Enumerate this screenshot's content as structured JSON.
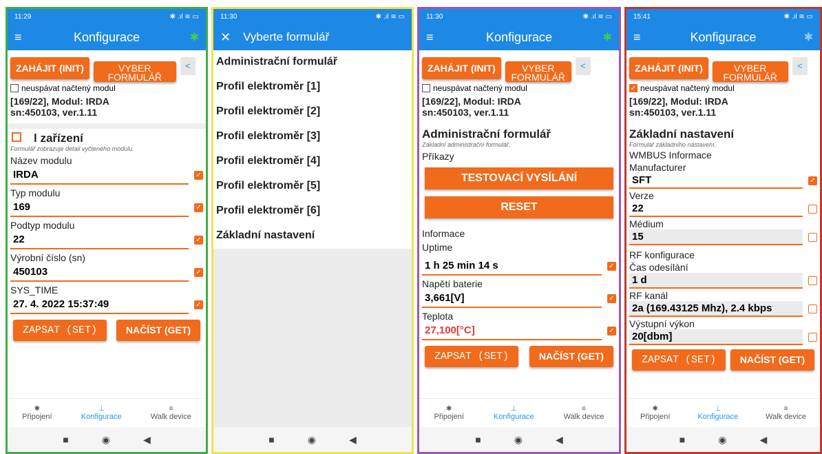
{
  "colors": {
    "accent": "#f26a1b",
    "appbar": "#1e88e5",
    "phone1_border": "#3fae49",
    "phone2_border": "#f0e44a",
    "phone3_border": "#9b59b6",
    "phone4_border": "#c0392b"
  },
  "common": {
    "title_config": "Konfigurace",
    "init": "ZAHÁJIT (INIT)",
    "vyber": "VYBER FORMULÁŘ",
    "no_sleep": "neuspávat načtený modul",
    "module_info_1": "[169/22], Modul: IRDA",
    "module_info_2": "sn:450103, ver.1.11",
    "set": "ZAPSAT (SET)",
    "get": "NAČÍST (GET)",
    "nav_conn": "Připojení",
    "nav_conf": "Konfigurace",
    "nav_walk": "Walk device"
  },
  "phone1": {
    "time": "11:29",
    "form_title": "l zařízení",
    "form_desc": "Formulář zobrazuje detail vyčteného modulu.",
    "fields": [
      {
        "label": "Název modulu",
        "value": "IRDA"
      },
      {
        "label": "Typ modulu",
        "value": "169"
      },
      {
        "label": "Podtyp modulu",
        "value": "22"
      },
      {
        "label": "Výrobní číslo (sn)",
        "value": "450103"
      },
      {
        "label": "SYS_TIME",
        "value": "27. 4. 2022 15:37:49"
      }
    ]
  },
  "phone2": {
    "time": "11:30",
    "title": "Vyberte formulář",
    "items": [
      "Administrační formulář",
      "Profil elektroměr [1]",
      "Profil elektroměr [2]",
      "Profil elektroměr [3]",
      "Profil elektroměr [4]",
      "Profil elektroměr [5]",
      "Profil elektroměr [6]",
      "Základní nastavení"
    ]
  },
  "phone3": {
    "time": "11:30",
    "form_title": "Administrační formulář",
    "form_desc": "Základní administrační formulář.",
    "commands": "Příkazy",
    "btn_test": "TESTOVACÍ VYSÍLÁNÍ",
    "btn_reset": "RESET",
    "info": "Informace",
    "fields": [
      {
        "label": "Uptime",
        "value": "1 h 25 min 14 s"
      },
      {
        "label": "Napětí baterie",
        "value": "3,661[V]"
      },
      {
        "label": "Teplota",
        "value": "27,100[°C]"
      }
    ]
  },
  "phone4": {
    "time": "15:41",
    "form_title": "Základní nastavení",
    "form_desc": "Formulář základního nastavení.",
    "wmbus": "WMBUS Informace",
    "rf_conf": "RF konfigurace",
    "fields": [
      {
        "label": "Manufacturer",
        "value": "SFT"
      },
      {
        "label": "Verze",
        "value": "22"
      },
      {
        "label": "Médium",
        "value": "15"
      },
      {
        "label": "Čas odesílání",
        "value": "1 d"
      },
      {
        "label": "RF kanál",
        "value": "2a (169.43125 Mhz), 2.4 kbps"
      },
      {
        "label": "Výstupní výkon",
        "value": "20[dbm]"
      }
    ]
  }
}
